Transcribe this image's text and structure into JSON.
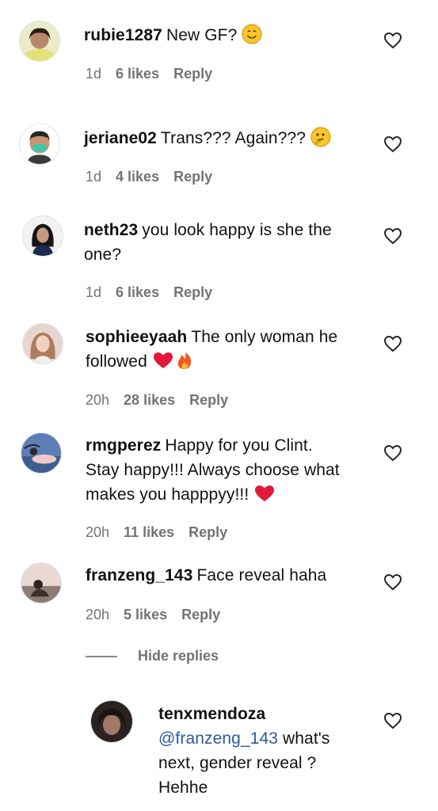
{
  "comments": [
    {
      "username": "rubie1287",
      "text": "New GF?",
      "time": "1d",
      "likes": "6 likes",
      "reply": "Reply"
    },
    {
      "username": "jeriane02",
      "text": "Trans??? Again???",
      "time": "1d",
      "likes": "4 likes",
      "reply": "Reply"
    },
    {
      "username": "neth23",
      "text": "you look happy is she the",
      "text2": "one?",
      "time": "1d",
      "likes": "6 likes",
      "reply": "Reply"
    },
    {
      "username": "sophieeyaah",
      "text": "The only woman he",
      "text2": "followed",
      "time": "20h",
      "likes": "28 likes",
      "reply": "Reply"
    },
    {
      "username": "rmgperez",
      "text": "Happy for you Clint.",
      "text2": "Stay happy!!! Always choose what",
      "text3": "makes you happpyy!!!",
      "time": "20h",
      "likes": "11 likes",
      "reply": "Reply"
    },
    {
      "username": "franzeng_143",
      "text": "Face reveal haha",
      "time": "20h",
      "likes": "5 likes",
      "reply": "Reply"
    }
  ],
  "hide_replies": "Hide replies",
  "reply_comment": {
    "username": "tenxmendoza",
    "mention": "@franzeng_143",
    "text": "what's",
    "text2": "next, gender reveal ?",
    "text3": "Hehhe"
  },
  "icons": {
    "like": "heart-outline-icon",
    "emoji_smile": "smiling-face-emoji",
    "emoji_thinking": "thinking-face-emoji",
    "emoji_heart": "red-heart-emoji",
    "emoji_fire": "fire-emoji"
  }
}
